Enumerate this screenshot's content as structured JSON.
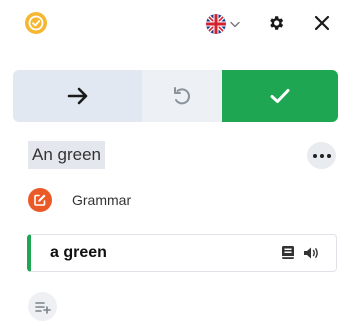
{
  "header": {
    "logo_icon": "check-circle-icon",
    "language_icon": "uk-flag-icon",
    "settings_icon": "gear-icon",
    "close_icon": "close-icon",
    "brand_color": "#f5b731"
  },
  "actions": {
    "next_icon": "arrow-right-icon",
    "undo_icon": "undo-icon",
    "accept_icon": "checkmark-icon",
    "accept_color": "#1ea653"
  },
  "match": {
    "original_text": "An green",
    "more_icon": "more-horizontal-icon",
    "category_label": "Grammar",
    "category_icon": "pencil-edit-icon",
    "category_color": "#ea5a26"
  },
  "suggestion": {
    "text": "a green",
    "dictionary_icon": "book-icon",
    "speak_icon": "speaker-icon"
  },
  "footer": {
    "add_rule_icon": "add-to-list-icon"
  }
}
